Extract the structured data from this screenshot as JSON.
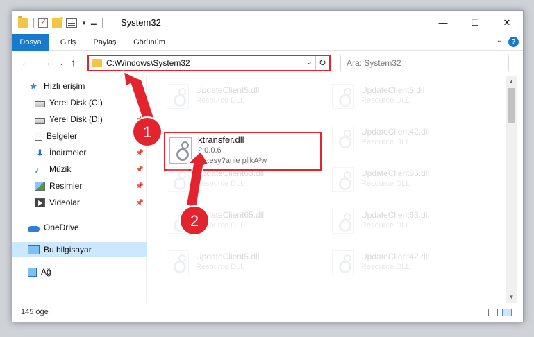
{
  "window": {
    "title": "System32",
    "minimize": "—",
    "maximize": "☐",
    "close": "✕"
  },
  "ribbon": {
    "tabs": [
      "Dosya",
      "Giriş",
      "Paylaş",
      "Görünüm"
    ],
    "help": "?"
  },
  "address": {
    "path": "C:\\Windows\\System32",
    "search_placeholder": "Ara: System32"
  },
  "nav": {
    "quick_access": "Hızlı erişim",
    "items": [
      {
        "label": "Yerel Disk (C:)",
        "icon": "drive-icon",
        "pinned": false
      },
      {
        "label": "Yerel Disk (D:)",
        "icon": "drive-icon",
        "pinned": true
      },
      {
        "label": "Belgeler",
        "icon": "documents-icon",
        "pinned": true
      },
      {
        "label": "İndirmeler",
        "icon": "download-icon",
        "pinned": true
      },
      {
        "label": "Müzik",
        "icon": "music-icon",
        "pinned": true
      },
      {
        "label": "Resimler",
        "icon": "pictures-icon",
        "pinned": true
      },
      {
        "label": "Videolar",
        "icon": "videos-icon",
        "pinned": true
      }
    ],
    "onedrive": "OneDrive",
    "this_pc": "Bu bilgisayar",
    "network": "Ağ"
  },
  "files": [
    {
      "name": "UpdateClient5.dll",
      "desc": "Resource DLL"
    },
    {
      "name": "UpdateClient5.dll",
      "desc": "Resource DLL"
    },
    {
      "name": "UpdateClient42.dll",
      "desc": "Resource DLL"
    },
    {
      "name": "UpdateClient63.dll",
      "desc": "Resource DLL"
    },
    {
      "name": "UpdateClient65.dll",
      "desc": "Resource DLL"
    },
    {
      "name": "UpdateClient65.dll",
      "desc": "Resource DLL"
    },
    {
      "name": "UpdateClient63.dll",
      "desc": "Resource DLL"
    },
    {
      "name": "UpdateClient5.dll",
      "desc": "Resource DLL"
    },
    {
      "name": "UpdateClient42.dll",
      "desc": "Resource DLL"
    }
  ],
  "highlighted_file": {
    "name": "ktransfer.dll",
    "version": "2.0.0.6",
    "desc": "Przesy?anie plikA³w"
  },
  "status": {
    "count": "145 öğe"
  },
  "annotations": {
    "step1": "1",
    "step2": "2",
    "accent": "#e3232e"
  }
}
